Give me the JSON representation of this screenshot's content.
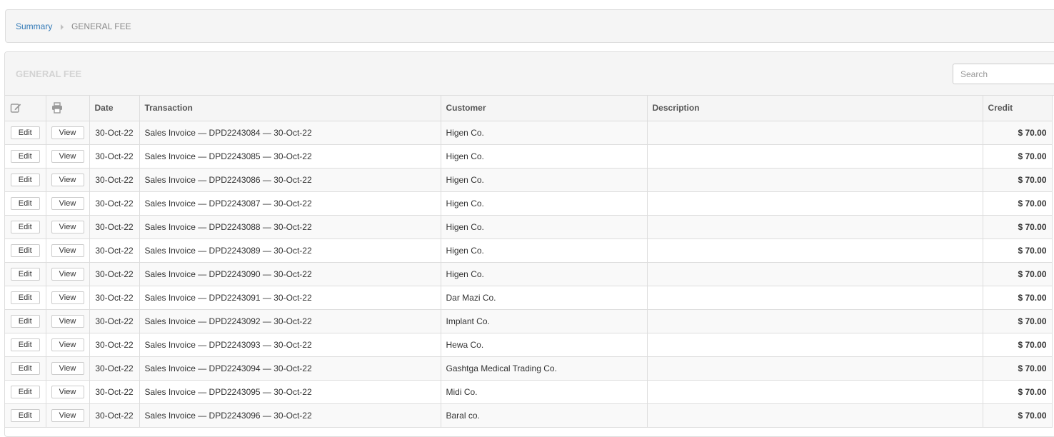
{
  "breadcrumb": {
    "link_label": "Summary",
    "current_label": "GENERAL FEE"
  },
  "panel": {
    "title": "GENERAL FEE",
    "search_placeholder": "Search"
  },
  "icons": {
    "edit_header": "edit-icon",
    "print_header": "print-icon"
  },
  "table": {
    "columns": {
      "date": "Date",
      "transaction": "Transaction",
      "customer": "Customer",
      "description": "Description",
      "credit": "Credit"
    },
    "edit_label": "Edit",
    "view_label": "View",
    "rows": [
      {
        "date": "30-Oct-22",
        "transaction": "Sales Invoice — DPD2243084 — 30-Oct-22",
        "customer": "Higen Co.",
        "description": "",
        "credit": "$ 70.00"
      },
      {
        "date": "30-Oct-22",
        "transaction": "Sales Invoice — DPD2243085 — 30-Oct-22",
        "customer": "Higen Co.",
        "description": "",
        "credit": "$ 70.00"
      },
      {
        "date": "30-Oct-22",
        "transaction": "Sales Invoice — DPD2243086 — 30-Oct-22",
        "customer": "Higen Co.",
        "description": "",
        "credit": "$ 70.00"
      },
      {
        "date": "30-Oct-22",
        "transaction": "Sales Invoice — DPD2243087 — 30-Oct-22",
        "customer": "Higen Co.",
        "description": "",
        "credit": "$ 70.00"
      },
      {
        "date": "30-Oct-22",
        "transaction": "Sales Invoice — DPD2243088 — 30-Oct-22",
        "customer": "Higen Co.",
        "description": "",
        "credit": "$ 70.00"
      },
      {
        "date": "30-Oct-22",
        "transaction": "Sales Invoice — DPD2243089 — 30-Oct-22",
        "customer": "Higen Co.",
        "description": "",
        "credit": "$ 70.00"
      },
      {
        "date": "30-Oct-22",
        "transaction": "Sales Invoice — DPD2243090 — 30-Oct-22",
        "customer": "Higen Co.",
        "description": "",
        "credit": "$ 70.00"
      },
      {
        "date": "30-Oct-22",
        "transaction": "Sales Invoice — DPD2243091 — 30-Oct-22",
        "customer": "Dar Mazi Co.",
        "description": "",
        "credit": "$ 70.00"
      },
      {
        "date": "30-Oct-22",
        "transaction": "Sales Invoice — DPD2243092 — 30-Oct-22",
        "customer": "Implant Co.",
        "description": "",
        "credit": "$ 70.00"
      },
      {
        "date": "30-Oct-22",
        "transaction": "Sales Invoice — DPD2243093 — 30-Oct-22",
        "customer": "Hewa Co.",
        "description": "",
        "credit": "$ 70.00"
      },
      {
        "date": "30-Oct-22",
        "transaction": "Sales Invoice — DPD2243094 — 30-Oct-22",
        "customer": "Gashtga Medical Trading Co.",
        "description": "",
        "credit": "$ 70.00"
      },
      {
        "date": "30-Oct-22",
        "transaction": "Sales Invoice — DPD2243095 — 30-Oct-22",
        "customer": "Midi Co.",
        "description": "",
        "credit": "$ 70.00"
      },
      {
        "date": "30-Oct-22",
        "transaction": "Sales Invoice — DPD2243096 — 30-Oct-22",
        "customer": "Baral co.",
        "description": "",
        "credit": "$ 70.00"
      }
    ]
  }
}
